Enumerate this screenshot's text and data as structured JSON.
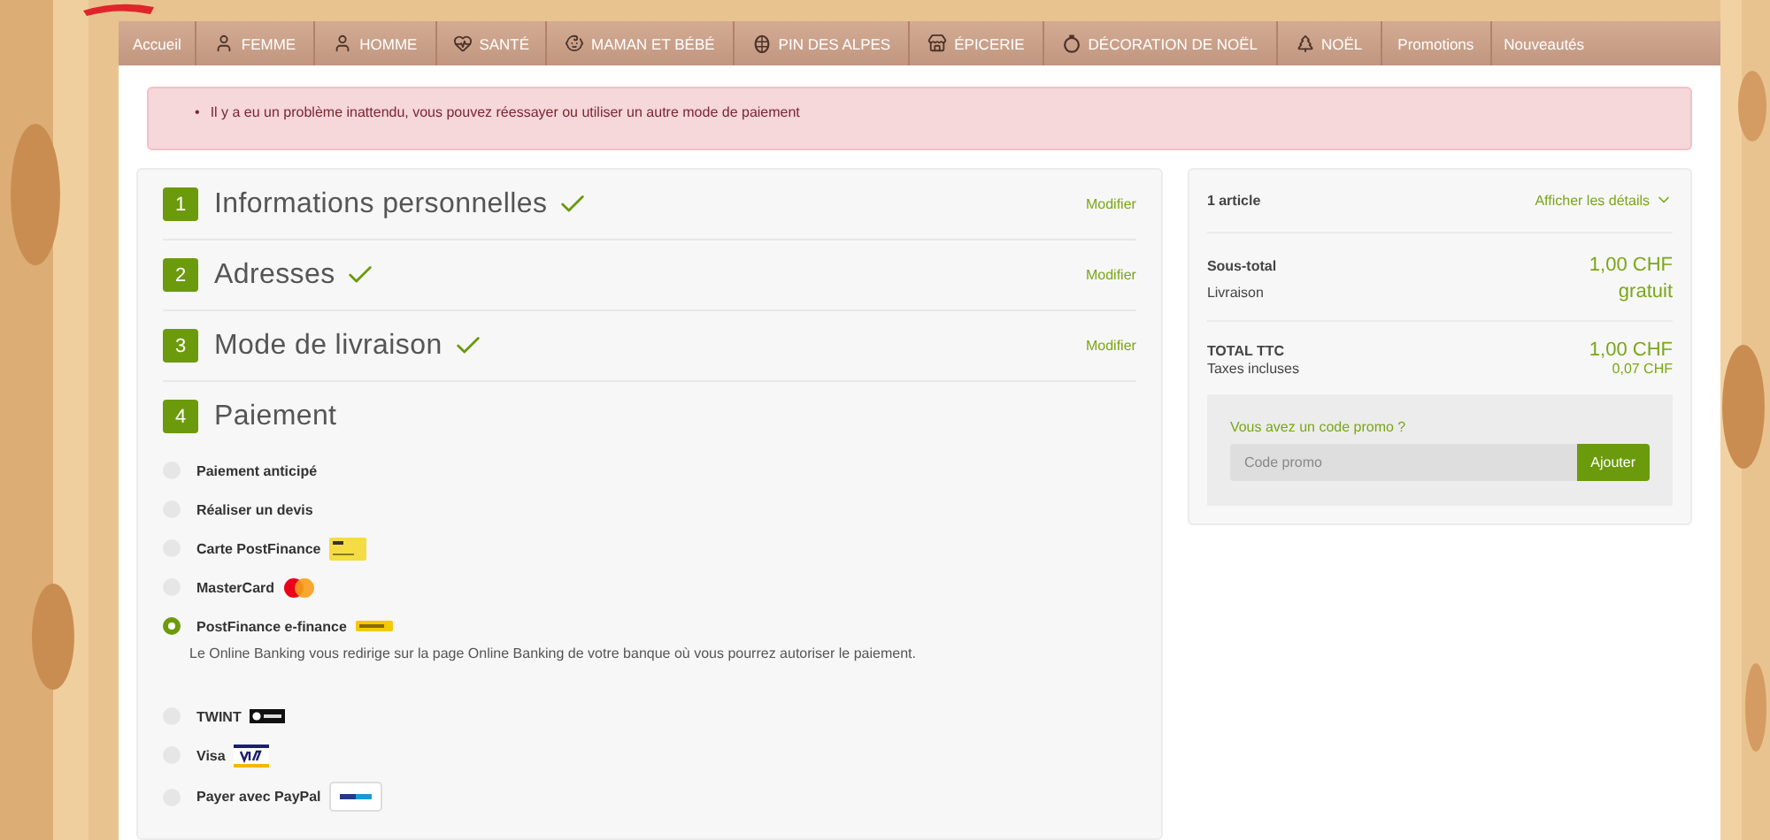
{
  "nav": [
    {
      "label": "Accueil"
    },
    {
      "label": "FEMME"
    },
    {
      "label": "HOMME"
    },
    {
      "label": "SANTÉ"
    },
    {
      "label": "MAMAN ET BÉBÉ"
    },
    {
      "label": "PIN DES ALPES"
    },
    {
      "label": "ÉPICERIE"
    },
    {
      "label": "DÉCORATION DE NOËL"
    },
    {
      "label": "NOËL"
    },
    {
      "label": "Promotions"
    },
    {
      "label": "Nouveautés"
    }
  ],
  "alert": {
    "bullet": "•",
    "message": "Il y a eu un problème inattendu, vous pouvez réessayer ou utiliser un autre mode de paiement"
  },
  "steps": [
    {
      "number": "1",
      "title": "Informations personnelles",
      "done": true,
      "action": "Modifier"
    },
    {
      "number": "2",
      "title": "Adresses",
      "done": true,
      "action": "Modifier"
    },
    {
      "number": "3",
      "title": "Mode de livraison",
      "done": true,
      "action": "Modifier"
    },
    {
      "number": "4",
      "title": "Paiement",
      "done": false
    }
  ],
  "payment_options": [
    {
      "label": "Paiement anticipé",
      "selected": false
    },
    {
      "label": "Réaliser un devis",
      "selected": false
    },
    {
      "label": "Carte PostFinance",
      "selected": false,
      "kind": "postfinance-card"
    },
    {
      "label": "MasterCard",
      "selected": false,
      "kind": "mastercard"
    },
    {
      "label": "PostFinance e-finance",
      "selected": true,
      "kind": "postfinance-badge",
      "description": "Le Online Banking vous redirige sur la page Online Banking de votre banque où vous pourrez autoriser le paiement."
    },
    {
      "label": "TWINT",
      "selected": false,
      "kind": "twint"
    },
    {
      "label": "Visa",
      "selected": false,
      "kind": "visa"
    },
    {
      "label": "Payer avec PayPal",
      "selected": false,
      "kind": "paypal"
    }
  ],
  "summary": {
    "count": "1 article",
    "details_link": "Afficher les détails",
    "lines": [
      {
        "label": "Sous-total",
        "value": "1,00 CHF",
        "bold": true
      },
      {
        "label": "Livraison",
        "value": "gratuit",
        "bold": false
      }
    ],
    "total_label": "TOTAL TTC",
    "total_value": "1,00 CHF",
    "tax_label": "Taxes incluses",
    "tax_value": "0,07 CHF",
    "promo": {
      "title": "Vous avez un code promo ?",
      "placeholder": "Code promo",
      "button": "Ajouter"
    }
  }
}
